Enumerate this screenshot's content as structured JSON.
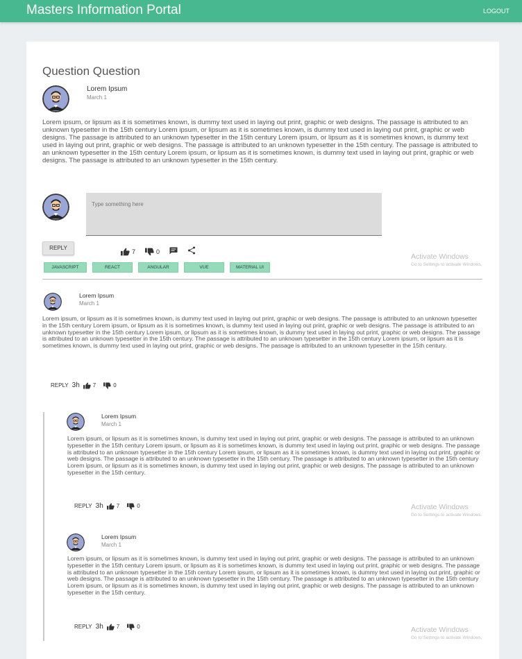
{
  "header": {
    "title": "Masters Information Portal",
    "logout_label": "LOGOUT"
  },
  "question": {
    "title": "Question Question",
    "author": "Lorem Ipsum",
    "date": "March 1",
    "body": "Lorem ipsum, or lipsum as it is sometimes known, is dummy text used in laying out print, graphic or web designs. The passage is attributed to an unknown typesetter in the 15th century Lorem ipsum, or lipsum as it is sometimes known, is dummy text used in laying out print, graphic or web designs. The passage is attributed to an unknown typesetter in the 15th century Lorem ipsum, or lipsum as it is sometimes known, is dummy text used in laying out print, graphic or web designs. The passage is attributed to an unknown typesetter in the 15th century. The passage is attributed to an unknown typesetter in the 15th century Lorem ipsum, or lipsum as it is sometimes known, is dummy text used in laying out print, graphic or web designs. The passage is attributed to an unknown typesetter in the 15th century.",
    "reply_placeholder": "Type something here",
    "reply_label": "REPLY",
    "likes": "7",
    "dislikes": "0",
    "tags": [
      "JAVASCRIPT",
      "REACT",
      "ANGULAR",
      "VUE",
      "MATERIAL UI"
    ]
  },
  "comments": [
    {
      "author": "Lorem Ipsum",
      "date": "March 1",
      "body": "Lorem ipsum, or lipsum as it is sometimes known, is dummy text used in laying out print, graphic or web designs. The passage is attributed to an unknown typesetter in the 15th century Lorem ipsum, or lipsum as it is sometimes known, is dummy text used in laying out print, graphic or web designs. The passage is attributed to an unknown typesetter in the 15th century Lorem ipsum, or lipsum as it is sometimes known, is dummy text used in laying out print, graphic or web designs. The passage is attributed to an unknown typesetter in the 15th century. The passage is attributed to an unknown typesetter in the 15th century Lorem ipsum, or lipsum as it is sometimes known, is dummy text used in laying out print, graphic or web designs. The passage is attributed to an unknown typesetter in the 15th century.",
      "reply_label": "REPLY",
      "time": "3h",
      "likes": "7",
      "dislikes": "0"
    },
    {
      "author": "Lorem Ipsum",
      "date": "March 1",
      "body": "Lorem ipsum, or lipsum as it is sometimes known, is dummy text used in laying out print, graphic or web designs. The passage is attributed to an unknown typesetter in the 15th century Lorem ipsum, or lipsum as it is sometimes known, is dummy text used in laying out print, graphic or web designs. The passage is attributed to an unknown typesetter in the 15th century Lorem ipsum, or lipsum as it is sometimes known, is dummy text used in laying out print, graphic or web designs. The passage is attributed to an unknown typesetter in the 15th century. The passage is attributed to an unknown typesetter in the 15th century Lorem ipsum, or lipsum as it is sometimes known, is dummy text used in laying out print, graphic or web designs. The passage is attributed to an unknown typesetter in the 15th century.",
      "reply_label": "REPLY",
      "time": "3h",
      "likes": "7",
      "dislikes": "0"
    },
    {
      "author": "Lorem Ipsum",
      "date": "March 1",
      "body": "Lorem ipsum, or lipsum as it is sometimes known, is dummy text used in laying out print, graphic or web designs. The passage is attributed to an unknown typesetter in the 15th century Lorem ipsum, or lipsum as it is sometimes known, is dummy text used in laying out print, graphic or web designs. The passage is attributed to an unknown typesetter in the 15th century Lorem ipsum, or lipsum as it is sometimes known, is dummy text used in laying out print, graphic or web designs. The passage is attributed to an unknown typesetter in the 15th century. The passage is attributed to an unknown typesetter in the 15th century Lorem ipsum, or lipsum as it is sometimes known, is dummy text used in laying out print, graphic or web designs. The passage is attributed to an unknown typesetter in the 15th century.",
      "reply_label": "REPLY",
      "time": "3h",
      "likes": "7",
      "dislikes": "0"
    }
  ],
  "watermark": {
    "title": "Activate Windows",
    "subtitle": "Go to Settings to activate Windows."
  },
  "colors": {
    "header": "#48b891",
    "tag": "#95dbb9",
    "page_bg": "#eceff2"
  },
  "icons": [
    "avatar-icon",
    "thumb-up-icon",
    "thumb-down-icon",
    "comment-icon",
    "share-icon"
  ]
}
